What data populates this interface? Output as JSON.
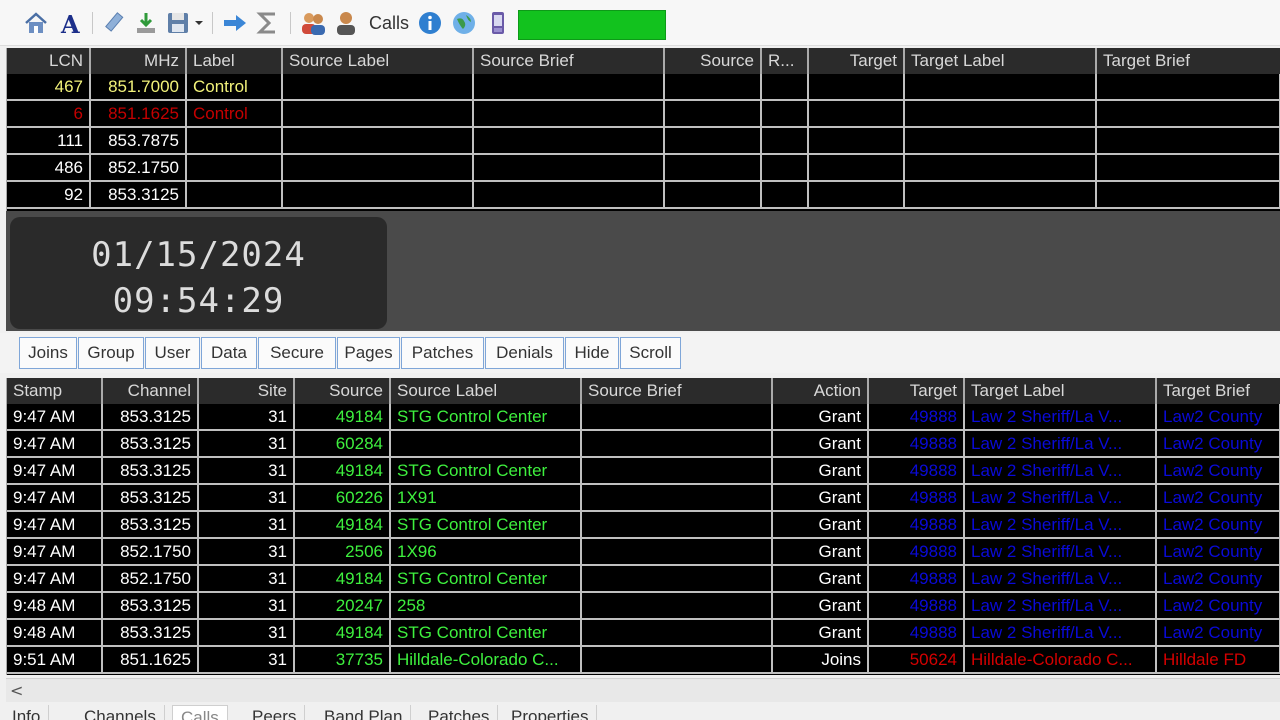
{
  "toolbar": {
    "icons": [
      "home-icon",
      "font-icon",
      "edit-icon",
      "download-icon",
      "save-icon",
      "chevron-down-icon",
      "forward-icon",
      "sum-icon",
      "users-icon",
      "user-icon",
      "info-icon",
      "globe-icon",
      "phone-icon"
    ],
    "calls_label": "Calls",
    "status_color": "#12c21e"
  },
  "channels": {
    "headers": [
      "LCN",
      "MHz",
      "Label",
      "Source Label",
      "Source Brief",
      "Source",
      "R...",
      "Target",
      "Target Label",
      "Target Brief"
    ],
    "rows": [
      {
        "lcn": "467",
        "mhz": "851.7000",
        "label": "Control",
        "color": "#f2f27a"
      },
      {
        "lcn": "6",
        "mhz": "851.1625",
        "label": "Control",
        "color": "#c40000"
      },
      {
        "lcn": "111",
        "mhz": "853.7875",
        "label": "",
        "color": "#ffffff"
      },
      {
        "lcn": "486",
        "mhz": "852.1750",
        "label": "",
        "color": "#ffffff"
      },
      {
        "lcn": "92",
        "mhz": "853.3125",
        "label": "",
        "color": "#ffffff"
      }
    ]
  },
  "clock": {
    "date": "01/15/2024",
    "time": "09:54:29"
  },
  "filters": [
    "Joins",
    "Group",
    "User",
    "Data",
    "Secure",
    "Pages",
    "Patches",
    "Denials",
    "Hide",
    "Scroll"
  ],
  "calls": {
    "headers": [
      "Stamp",
      "Channel",
      "Site",
      "Source",
      "Source Label",
      "Source Brief",
      "Action",
      "Target",
      "Target Label",
      "Target Brief"
    ],
    "rows": [
      {
        "stamp": "9:47 AM",
        "channel": "853.3125",
        "site": "31",
        "source": "49184",
        "source_label": "STG Control Center",
        "source_brief": "",
        "action": "Grant",
        "target": "49888",
        "target_label": "Law 2 Sheriff/La V...",
        "target_brief": "Law2 County",
        "tcolor": "#0a0ad8"
      },
      {
        "stamp": "9:47 AM",
        "channel": "853.3125",
        "site": "31",
        "source": "60284",
        "source_label": "",
        "source_brief": "",
        "action": "Grant",
        "target": "49888",
        "target_label": "Law 2 Sheriff/La V...",
        "target_brief": "Law2 County",
        "tcolor": "#0a0ad8"
      },
      {
        "stamp": "9:47 AM",
        "channel": "853.3125",
        "site": "31",
        "source": "49184",
        "source_label": "STG Control Center",
        "source_brief": "",
        "action": "Grant",
        "target": "49888",
        "target_label": "Law 2 Sheriff/La V...",
        "target_brief": "Law2 County",
        "tcolor": "#0a0ad8"
      },
      {
        "stamp": "9:47 AM",
        "channel": "853.3125",
        "site": "31",
        "source": "60226",
        "source_label": "1X91",
        "source_brief": "",
        "action": "Grant",
        "target": "49888",
        "target_label": "Law 2 Sheriff/La V...",
        "target_brief": "Law2 County",
        "tcolor": "#0a0ad8"
      },
      {
        "stamp": "9:47 AM",
        "channel": "853.3125",
        "site": "31",
        "source": "49184",
        "source_label": "STG Control Center",
        "source_brief": "",
        "action": "Grant",
        "target": "49888",
        "target_label": "Law 2 Sheriff/La V...",
        "target_brief": "Law2 County",
        "tcolor": "#0a0ad8"
      },
      {
        "stamp": "9:47 AM",
        "channel": "852.1750",
        "site": "31",
        "source": "2506",
        "source_label": "1X96",
        "source_brief": "",
        "action": "Grant",
        "target": "49888",
        "target_label": "Law 2 Sheriff/La V...",
        "target_brief": "Law2 County",
        "tcolor": "#0a0ad8"
      },
      {
        "stamp": "9:47 AM",
        "channel": "852.1750",
        "site": "31",
        "source": "49184",
        "source_label": "STG Control Center",
        "source_brief": "",
        "action": "Grant",
        "target": "49888",
        "target_label": "Law 2 Sheriff/La V...",
        "target_brief": "Law2 County",
        "tcolor": "#0a0ad8"
      },
      {
        "stamp": "9:48 AM",
        "channel": "853.3125",
        "site": "31",
        "source": "20247",
        "source_label": "258",
        "source_brief": "",
        "action": "Grant",
        "target": "49888",
        "target_label": "Law 2 Sheriff/La V...",
        "target_brief": "Law2 County",
        "tcolor": "#0a0ad8"
      },
      {
        "stamp": "9:48 AM",
        "channel": "853.3125",
        "site": "31",
        "source": "49184",
        "source_label": "STG Control Center",
        "source_brief": "",
        "action": "Grant",
        "target": "49888",
        "target_label": "Law 2 Sheriff/La V...",
        "target_brief": "Law2 County",
        "tcolor": "#0a0ad8"
      },
      {
        "stamp": "9:51 AM",
        "channel": "851.1625",
        "site": "31",
        "source": "37735",
        "source_label": "Hilldale-Colorado C...",
        "source_brief": "",
        "action": "Joins",
        "target": "50624",
        "target_label": "Hilldale-Colorado C...",
        "target_brief": "Hilldale FD",
        "tcolor": "#d40000"
      }
    ]
  },
  "scrollbar": {
    "left_arrow": "<"
  },
  "bottom_tabs": {
    "items": [
      "Info",
      "Channels",
      "Calls",
      "Peers",
      "Band Plan",
      "Patches",
      "Properties"
    ],
    "active": "Calls"
  }
}
